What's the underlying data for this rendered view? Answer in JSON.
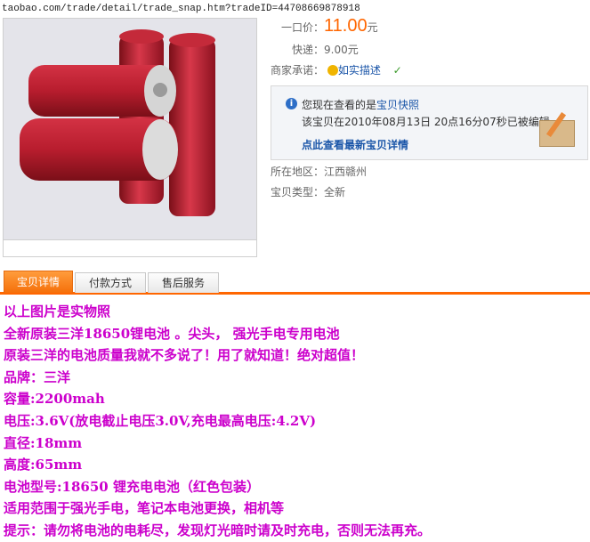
{
  "url": "taobao.com/trade/detail/trade_snap.htm?tradeID=44708669878918",
  "item": {
    "price_label": "一口价：",
    "price": "11.00",
    "price_unit": "元",
    "shipping_label": "快递：",
    "shipping_value": "9.00元",
    "commitment_label": "商家承诺：",
    "commitment_value": "如实描述",
    "location_label": "所在地区：",
    "location_value": "江西赣州",
    "type_label": "宝贝类型：",
    "type_value": "全新"
  },
  "snapshot": {
    "line1_prefix": "您现在查看的是",
    "line1_link": "宝贝快照",
    "line2": "该宝贝在2010年08月13日 20点16分07秒已被编辑。",
    "link_text": "点此查看最新宝贝详情"
  },
  "tabs": [
    {
      "label": "宝贝详情",
      "active": true
    },
    {
      "label": "付款方式",
      "active": false
    },
    {
      "label": "售后服务",
      "active": false
    }
  ],
  "description": [
    "以上图片是实物照",
    "全新原装三洋18650锂电池 。尖头， 强光手电专用电池",
    "原装三洋的电池质量我就不多说了！用了就知道！绝对超值！",
    "品牌：三洋",
    "容量:2200mah",
    "电压:3.6V(放电截止电压3.0V,充电最高电压:4.2V)",
    "直径:18mm",
    "高度:65mm",
    "电池型号:18650 锂充电电池（红色包装）",
    "适用范围于强光手电，笔记本电池更换，相机等",
    "提示：请勿将电池的电耗尽，发现灯光暗时请及时充电，否则无法再充。"
  ]
}
